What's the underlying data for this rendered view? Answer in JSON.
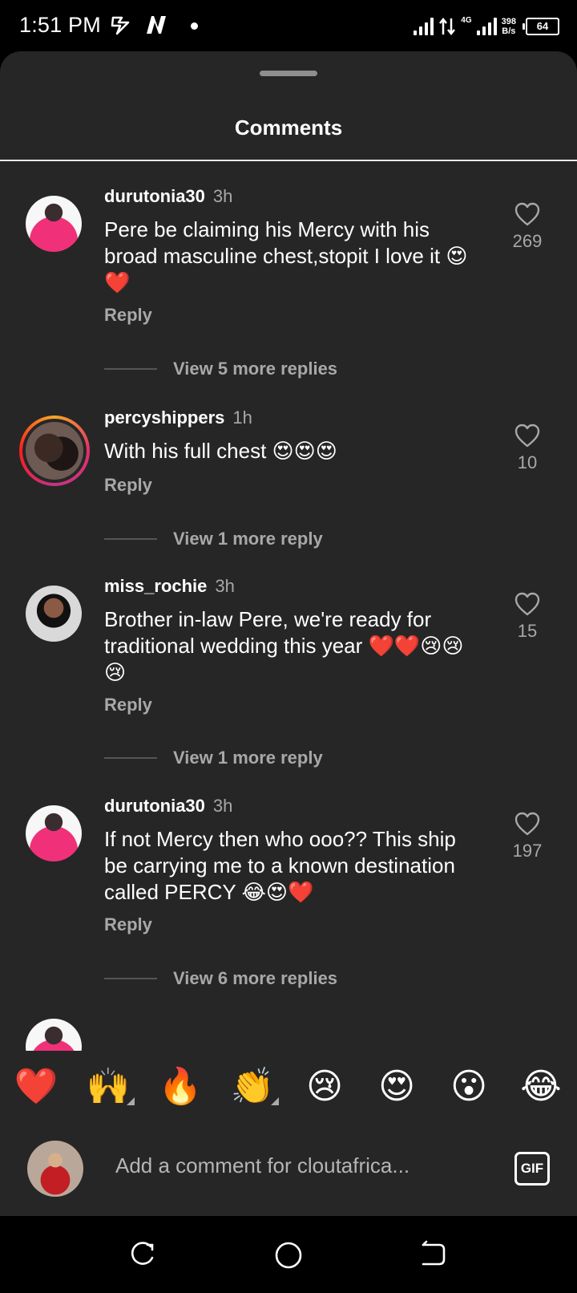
{
  "status_bar": {
    "time": "1:51 PM",
    "network_type": "4G",
    "net_speed_value": "398",
    "net_speed_unit": "B/s",
    "battery": "64"
  },
  "sheet": {
    "title": "Comments"
  },
  "comments": [
    {
      "username": "durutonia30",
      "time": "3h",
      "text": "Pere be claiming his Mercy with his broad masculine chest,stopit I love it 😍❤️",
      "reply_label": "Reply",
      "likes": "269",
      "more_replies": "View 5 more replies"
    },
    {
      "username": "percyshippers",
      "time": "1h",
      "text": "With his full chest 😍😍😍",
      "reply_label": "Reply",
      "likes": "10",
      "more_replies": "View 1 more reply"
    },
    {
      "username": "miss_rochie",
      "time": "3h",
      "text": "Brother in-law Pere, we're ready for traditional wedding this year ❤️❤️😢😢😢",
      "reply_label": "Reply",
      "likes": "15",
      "more_replies": "View 1 more reply"
    },
    {
      "username": "durutonia30",
      "time": "3h",
      "text": "If not Mercy then who ooo?? This ship be carrying me to a known destination called PERCY 😂😍❤️",
      "reply_label": "Reply",
      "likes": "197",
      "more_replies": "View 6 more replies"
    }
  ],
  "quick_reactions": [
    "❤️",
    "🙌",
    "🔥",
    "👏",
    "😢",
    "😍",
    "😮",
    "😂"
  ],
  "input": {
    "placeholder": "Add a comment for cloutafrica...",
    "gif_label": "GIF"
  },
  "icons": {
    "heart": "heart-outline-icon",
    "nav_recent": "recent-apps-icon",
    "nav_home": "home-icon",
    "nav_back": "back-icon"
  }
}
